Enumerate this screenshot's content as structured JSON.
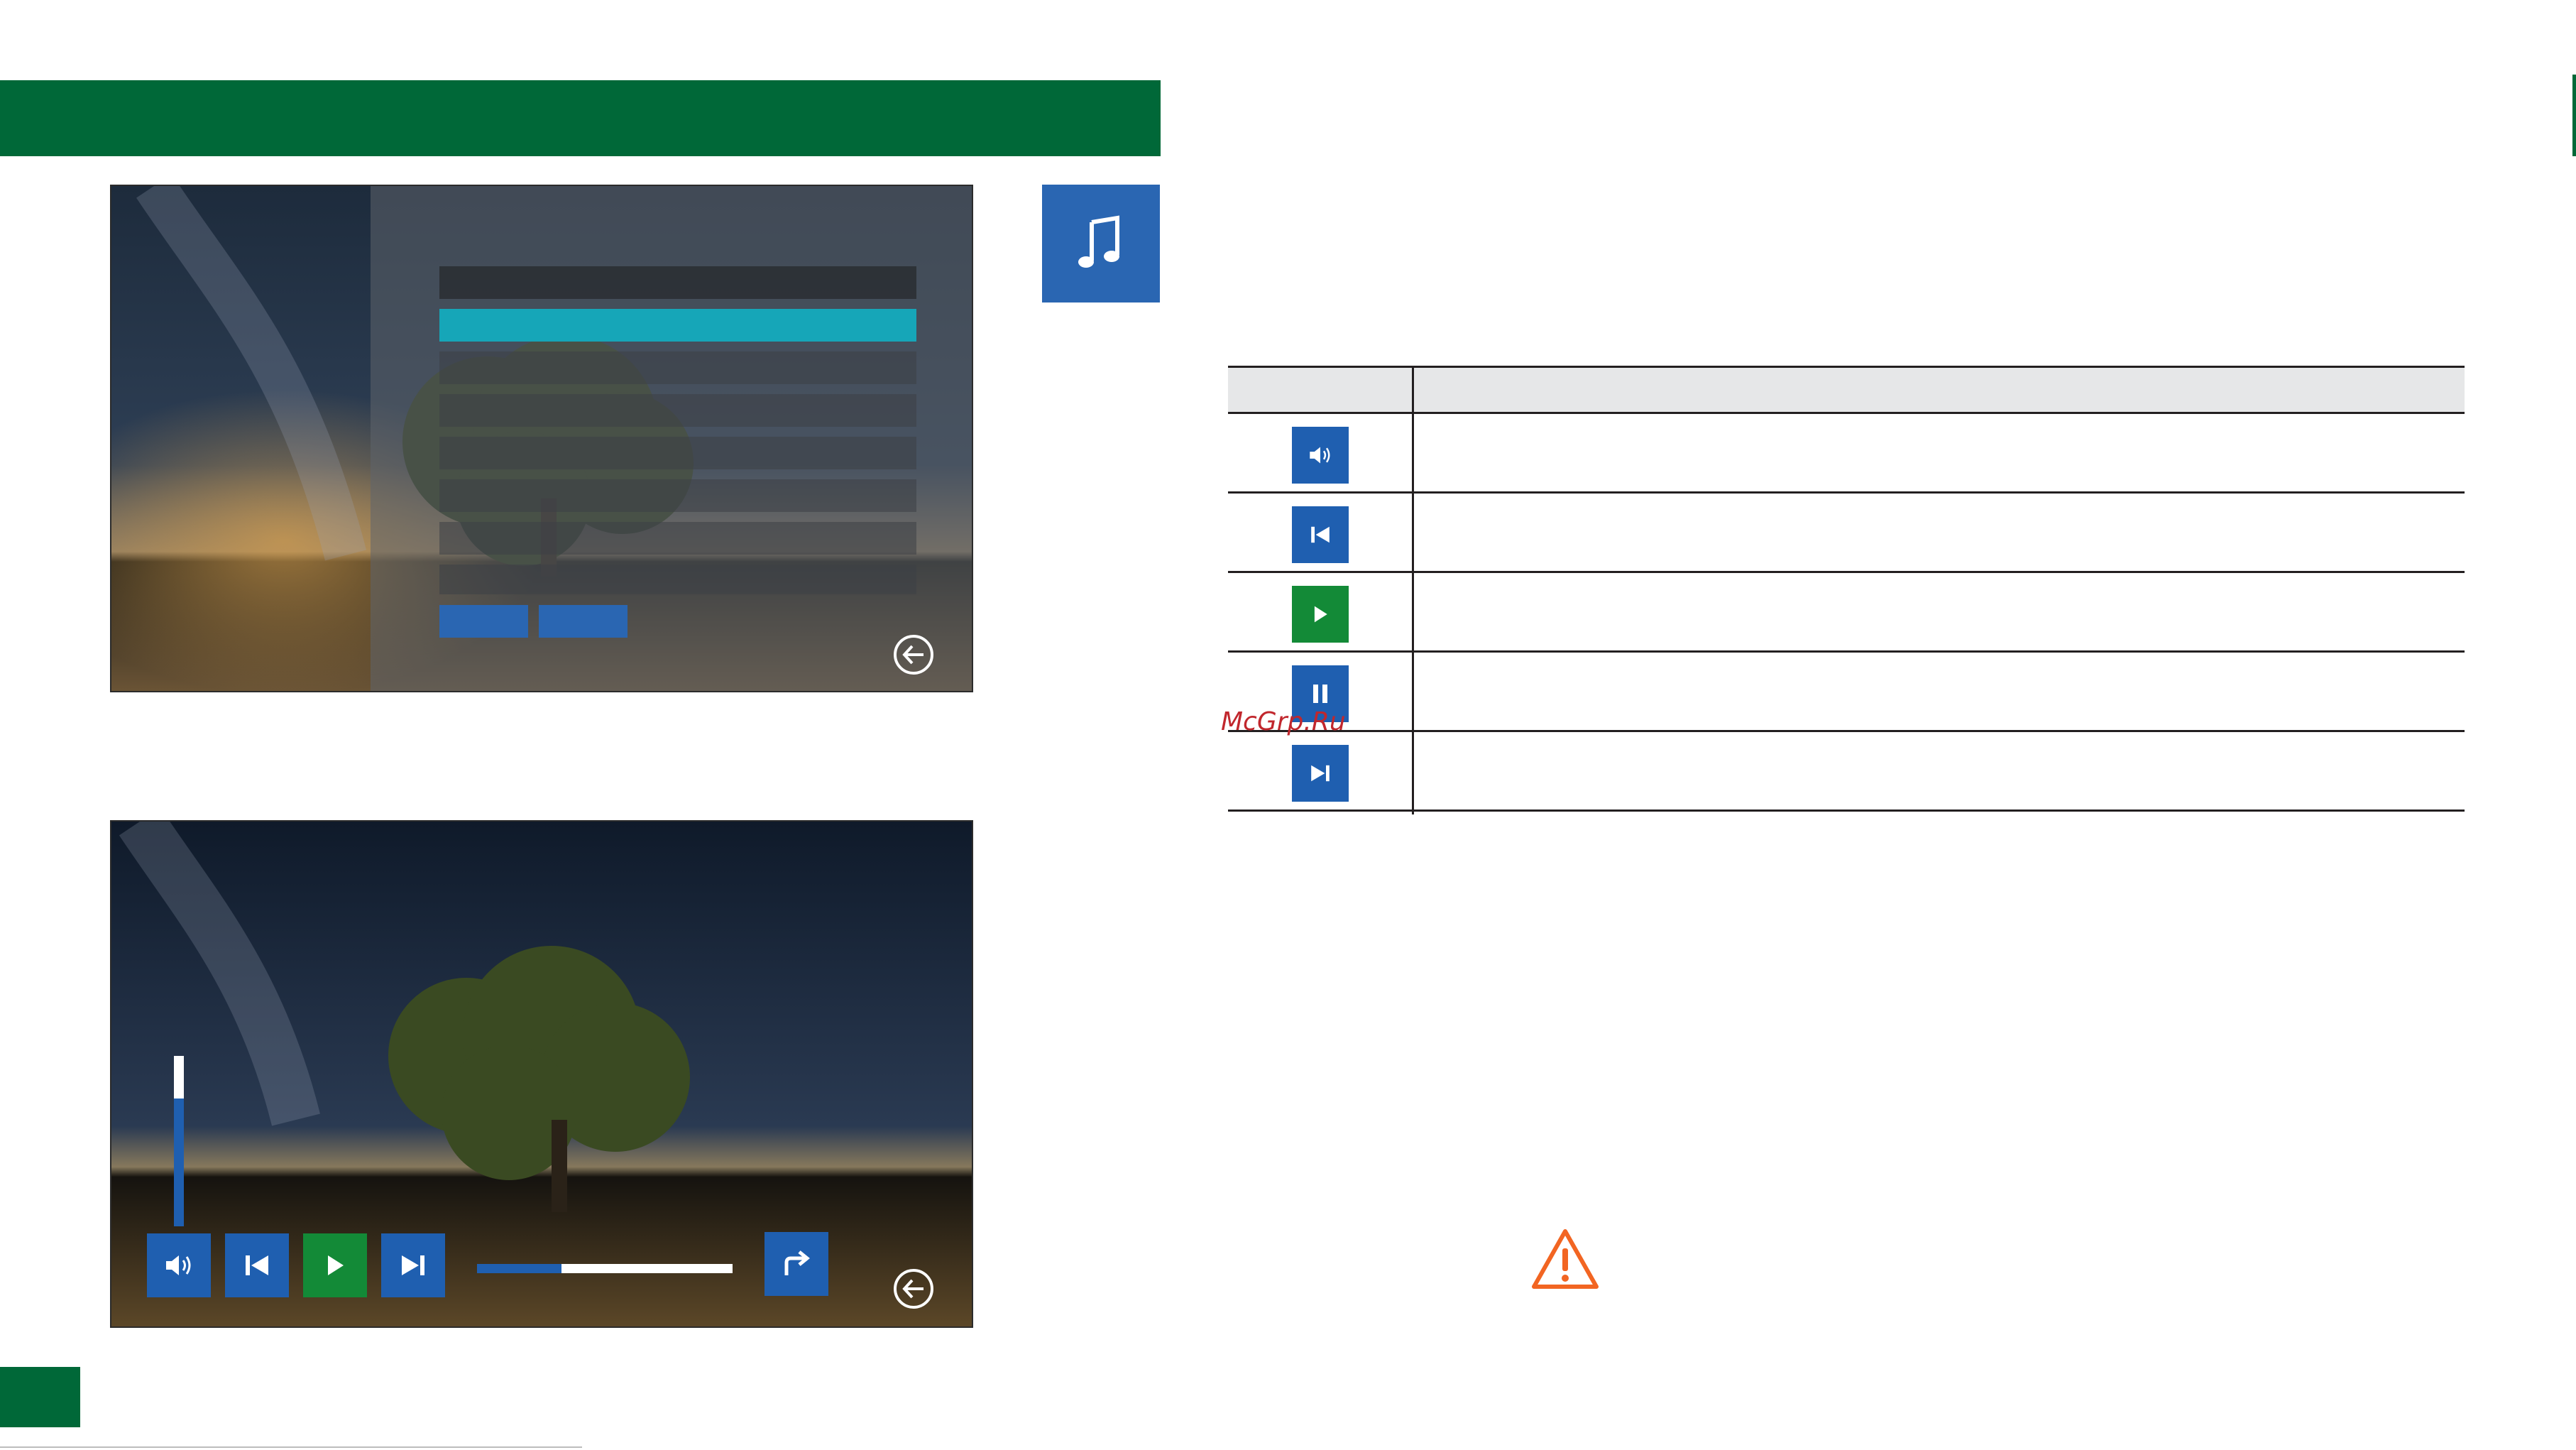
{
  "header": {
    "band_color": "#006838"
  },
  "music_tile": {
    "icon": "music-note-icon",
    "color": "#2a66b2"
  },
  "screen_playlist": {
    "playlist_rows": 8,
    "selected_row": 1,
    "buttons": 2,
    "back_icon": "back-arrow-icon"
  },
  "screen_player": {
    "controls": [
      {
        "icon": "volume-icon"
      },
      {
        "icon": "previous-track-icon"
      },
      {
        "icon": "play-icon"
      },
      {
        "icon": "next-track-icon"
      }
    ],
    "share_icon": "forward-arrow-icon",
    "back_icon": "back-arrow-icon",
    "volume_level": 0.75,
    "progress": 0.33
  },
  "legend": {
    "rows": [
      {
        "icon": "volume-icon",
        "color": "#1f5fb0"
      },
      {
        "icon": "previous-track-icon",
        "color": "#1f5fb0"
      },
      {
        "icon": "play-icon",
        "color": "#138a37"
      },
      {
        "icon": "pause-icon",
        "color": "#1f5fb0"
      },
      {
        "icon": "next-track-icon",
        "color": "#1f5fb0"
      }
    ]
  },
  "watermark": {
    "text": "McGrp.Ru"
  },
  "warning": {
    "icon": "warning-triangle-icon",
    "color": "#f26522"
  }
}
